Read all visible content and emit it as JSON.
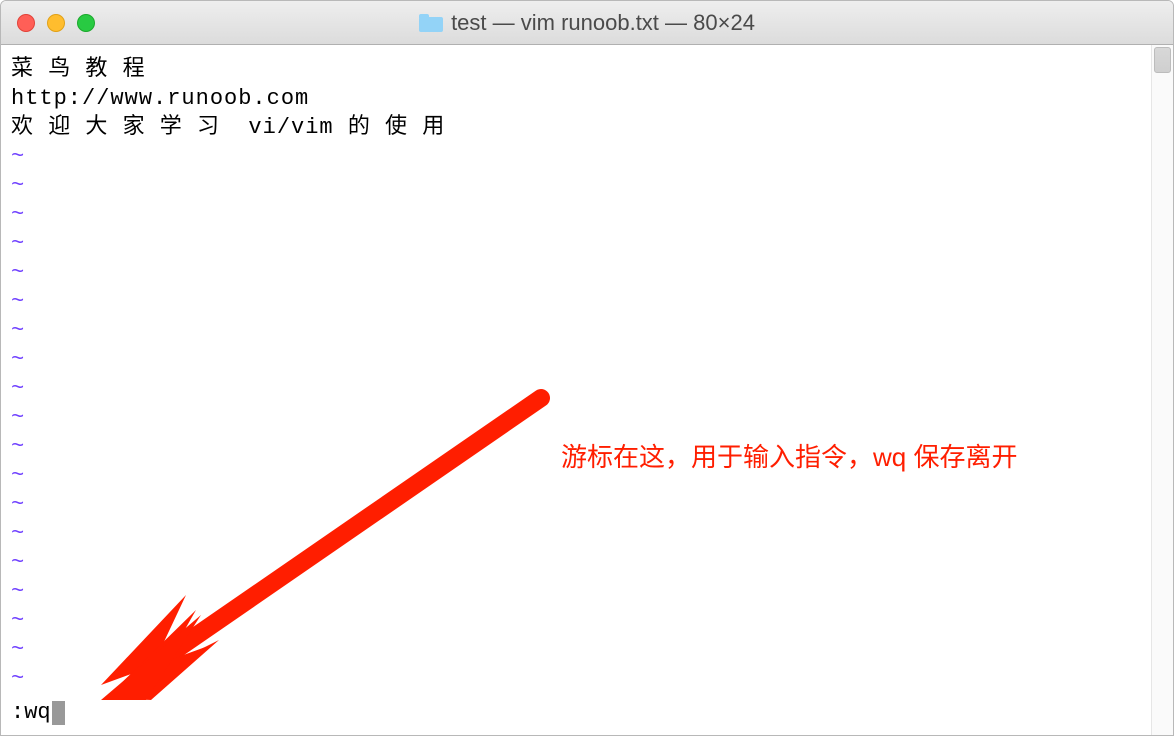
{
  "window": {
    "title": "test — vim runoob.txt — 80×24"
  },
  "editor": {
    "lines": [
      "菜 鸟 教 程",
      "http://www.runoob.com",
      "欢 迎 大 家 学 习  vi/vim 的 使 用"
    ],
    "tilde_count": 19,
    "command": ":wq"
  },
  "annotation": {
    "text": "游标在这，用于输入指令，wq 保存离开",
    "color": "#ff1e00"
  }
}
